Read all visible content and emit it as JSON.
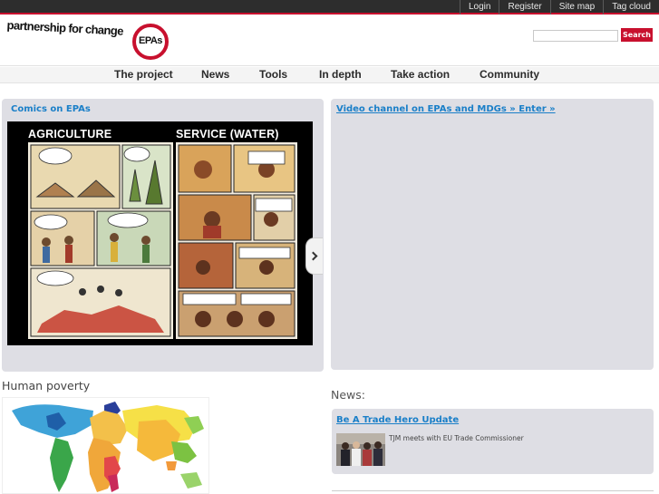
{
  "topbar": {
    "links": [
      "Login",
      "Register",
      "Site map",
      "Tag cloud"
    ]
  },
  "header": {
    "logo_text": "partnership for change",
    "logo_badge": "EPAs",
    "search_button": "Search",
    "search_value": ""
  },
  "nav": {
    "items": [
      "The project",
      "News",
      "Tools",
      "In depth",
      "Take action",
      "Community"
    ]
  },
  "comics": {
    "title": "Comics on EPAs",
    "left_title": "AGRICULTURE",
    "right_title": "SERVICE (WATER)"
  },
  "video": {
    "link": "Video channel on EPAs and MDGs » Enter »"
  },
  "poverty": {
    "title": "Human poverty"
  },
  "news": {
    "title": "News:",
    "item_link": "Be A Trade Hero Update",
    "item_caption": "TJM meets with EU Trade Commissioner"
  },
  "colors": {
    "accent": "#c8102e",
    "link": "#1a7fc8",
    "panel": "#dedee4",
    "topbar": "#2d2d2d"
  }
}
